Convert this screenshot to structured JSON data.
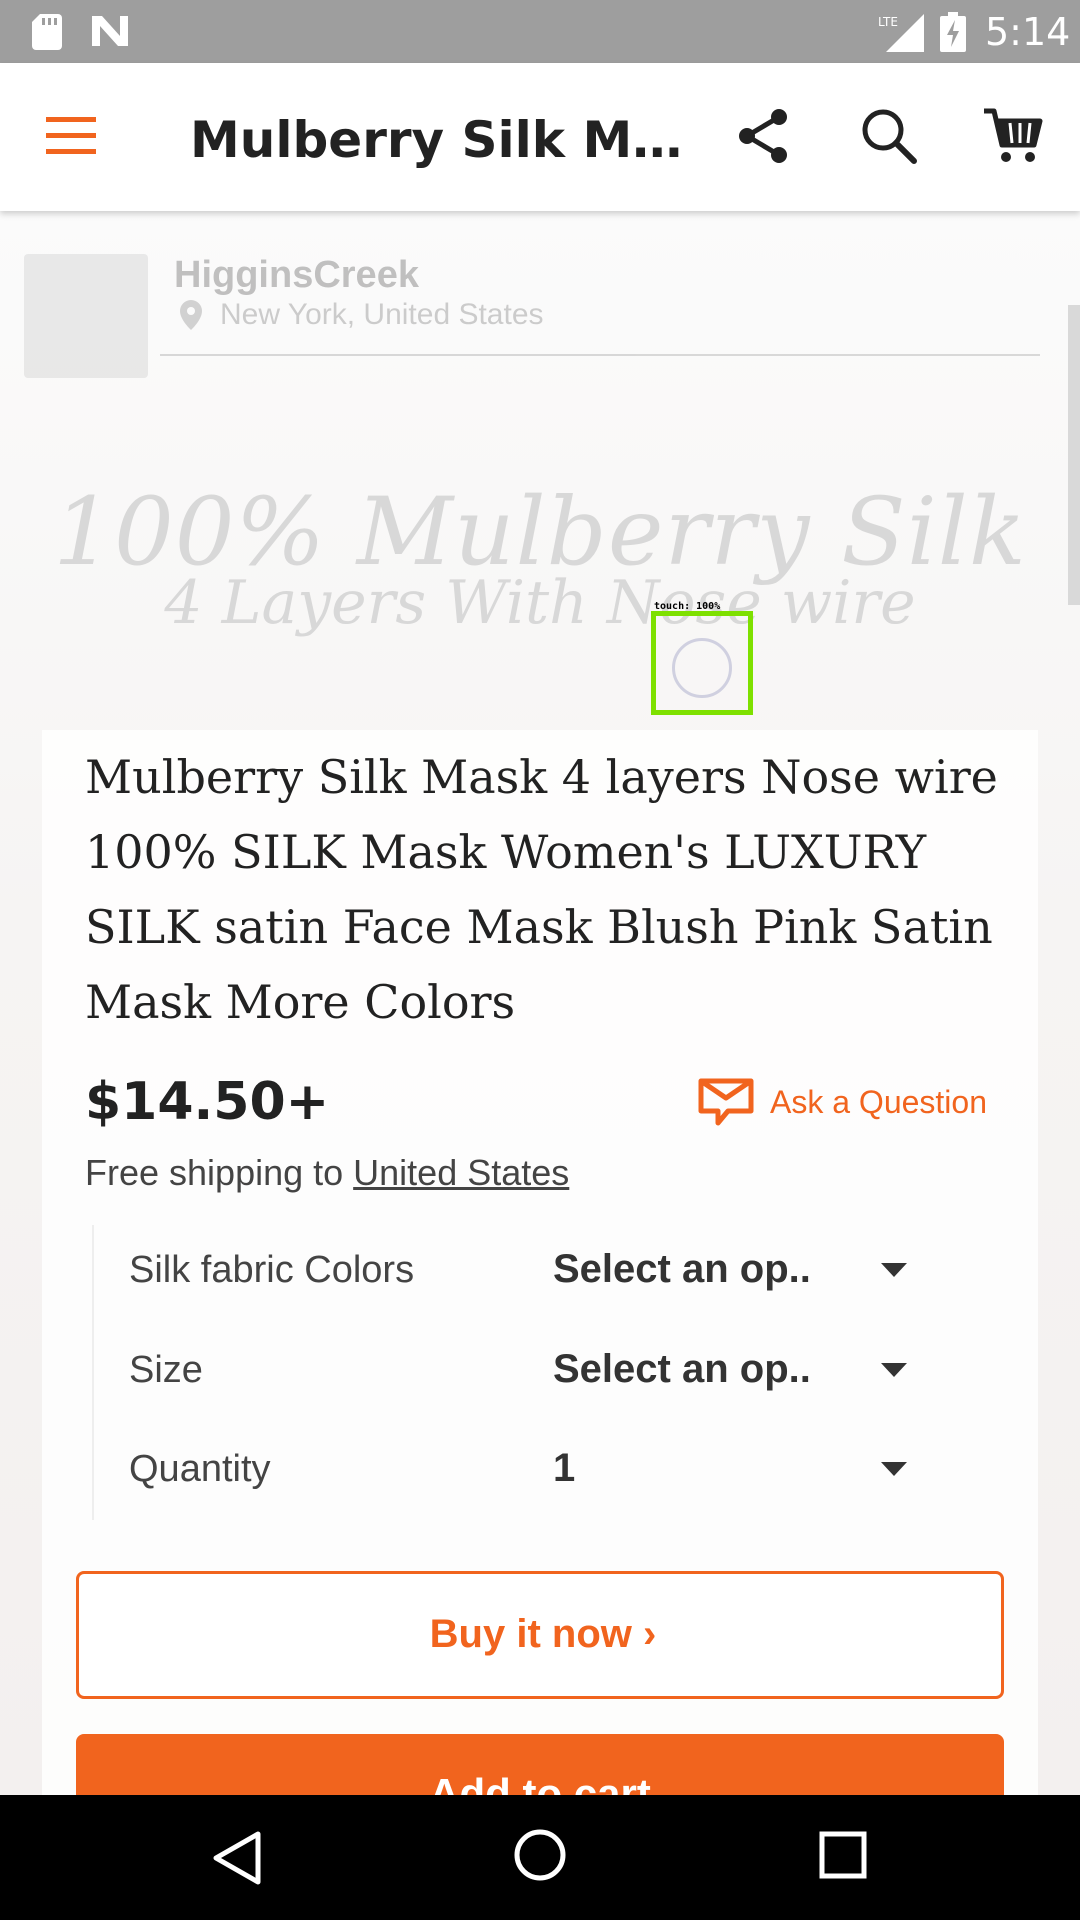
{
  "status_bar": {
    "time": "5:14",
    "network": "LTE",
    "icons": [
      "sd-card-icon",
      "notification-n-icon",
      "lte-signal-icon",
      "battery-charging-icon"
    ]
  },
  "app_bar": {
    "title": "Mulberry Silk Mas...",
    "icons": [
      "menu-icon",
      "share-icon",
      "search-icon",
      "cart-icon"
    ],
    "accent_color": "#f1641e"
  },
  "shop": {
    "name": "HigginsCreek",
    "location": "New York, United States"
  },
  "image_overlay": {
    "line1": "100% Mulberry Silk",
    "line2": "4 Layers With Nose wire"
  },
  "touch_indicator": {
    "label": "touch: 100%"
  },
  "product": {
    "title": "Mulberry Silk Mask 4 layers Nose wire 100% SILK Mask Women's LUXURY SILK satin Face Mask Blush Pink Satin Mask More Colors",
    "price": "$14.50+",
    "ask_question": "Ask a Question",
    "shipping_prefix": "Free shipping to ",
    "shipping_destination": "United States"
  },
  "options": [
    {
      "label": "Silk fabric Colors",
      "value": "Select an op.."
    },
    {
      "label": "Size",
      "value": "Select an op.."
    },
    {
      "label": "Quantity",
      "value": "1"
    }
  ],
  "actions": {
    "buy_now": "Buy it now ›",
    "add_to_cart": "Add to cart"
  },
  "nav_bar": {
    "icons": [
      "back-icon",
      "home-icon",
      "recents-icon"
    ]
  }
}
